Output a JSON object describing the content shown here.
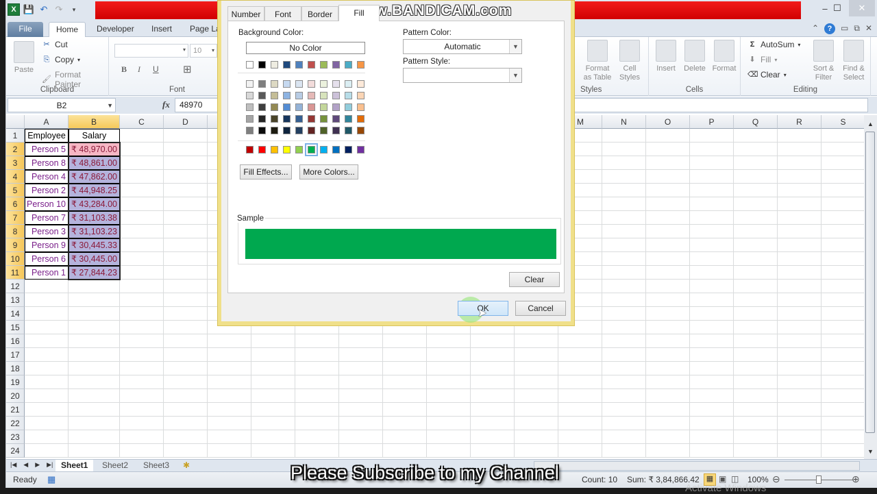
{
  "window": {
    "quick_access": [
      "excel-logo",
      "save",
      "undo",
      "redo",
      "customize"
    ],
    "controls": {
      "minimize": "–",
      "maximize": "☐",
      "close": "✕"
    }
  },
  "ribbon": {
    "tabs": [
      "File",
      "Home",
      "Developer",
      "Insert",
      "Page La"
    ],
    "clipboard": {
      "label": "Clipboard",
      "paste": "Paste",
      "cut": "Cut",
      "copy": "Copy",
      "format_painter": "Format Painter"
    },
    "font": {
      "label": "Font",
      "font_name": "",
      "font_size": "10",
      "bold": "B",
      "italic": "I",
      "underline": "U"
    },
    "styles": {
      "label": "Styles",
      "format_as_table": "Format as Table",
      "cell_styles": "Cell Styles"
    },
    "cells": {
      "label": "Cells",
      "insert": "Insert",
      "delete": "Delete",
      "format": "Format"
    },
    "editing": {
      "label": "Editing",
      "autosum": "AutoSum",
      "fill": "Fill",
      "clear": "Clear",
      "sort_filter": "Sort & Filter",
      "find_select": "Find & Select"
    }
  },
  "formula_bar": {
    "name_box": "B2",
    "fx": "fx",
    "value": "48970"
  },
  "sheet": {
    "columns_left": [
      "A",
      "B",
      "C",
      "D"
    ],
    "columns_right": [
      "M",
      "N",
      "O",
      "P",
      "Q",
      "R",
      "S"
    ],
    "rows": [
      "1",
      "2",
      "3",
      "4",
      "5",
      "6",
      "7",
      "8",
      "9",
      "10",
      "11",
      "12",
      "13",
      "14",
      "15",
      "16",
      "17",
      "18",
      "19",
      "20",
      "21",
      "22",
      "23",
      "24"
    ],
    "headers": {
      "employee": "Employee",
      "salary": "Salary"
    },
    "data": [
      {
        "employee": "Person 5",
        "salary": "₹ 48,970.00"
      },
      {
        "employee": "Person 8",
        "salary": "₹ 48,861.00"
      },
      {
        "employee": "Person 4",
        "salary": "₹ 47,862.00"
      },
      {
        "employee": "Person 2",
        "salary": "₹ 44,948.25"
      },
      {
        "employee": "Person 10",
        "salary": "₹ 43,284.00"
      },
      {
        "employee": "Person 7",
        "salary": "₹ 31,103.38"
      },
      {
        "employee": "Person 3",
        "salary": "₹ 31,103.23"
      },
      {
        "employee": "Person 9",
        "salary": "₹ 30,445.33"
      },
      {
        "employee": "Person 6",
        "salary": "₹ 30,445.00"
      },
      {
        "employee": "Person 1",
        "salary": "₹ 27,844.23"
      }
    ],
    "tabs": [
      "Sheet1",
      "Sheet2",
      "Sheet3"
    ],
    "active_tab": "Sheet1"
  },
  "status": {
    "ready": "Ready",
    "count": "Count: 10",
    "sum": "Sum: ₹ 3,84,866.42",
    "zoom": "100%",
    "zoom_level_percent": 100
  },
  "dialog": {
    "tabs": [
      "Number",
      "Font",
      "Border",
      "Fill"
    ],
    "active_tab": "Fill",
    "background_color_label": "Background Color:",
    "no_color": "No Color",
    "pattern_color_label": "Pattern Color:",
    "pattern_color_value": "Automatic",
    "pattern_style_label": "Pattern Style:",
    "pattern_style_value": "",
    "fill_effects": "Fill Effects...",
    "more_colors": "More Colors...",
    "sample_label": "Sample",
    "sample_color": "#00a84f",
    "clear": "Clear",
    "ok": "OK",
    "cancel": "Cancel",
    "theme_row": [
      "#ffffff",
      "#000000",
      "#eeece1",
      "#1f497d",
      "#4f81bd",
      "#c0504d",
      "#9bbb59",
      "#8064a2",
      "#4bacc6",
      "#f79646"
    ],
    "tint_rows": [
      [
        "#f2f2f2",
        "#7f7f7f",
        "#ddd9c3",
        "#c6d9f0",
        "#dbe5f1",
        "#f2dcdb",
        "#ebf1dd",
        "#e5e0ec",
        "#dbeef3",
        "#fdeada"
      ],
      [
        "#d8d8d8",
        "#595959",
        "#c4bd97",
        "#8db3e2",
        "#b8cce4",
        "#e5b9b7",
        "#d7e3bc",
        "#ccc1d9",
        "#b7dde8",
        "#fbd5b5"
      ],
      [
        "#bfbfbf",
        "#3f3f3f",
        "#938953",
        "#548dd4",
        "#95b3d7",
        "#d99694",
        "#c3d69b",
        "#b2a2c7",
        "#92cddc",
        "#fac08f"
      ],
      [
        "#a5a5a5",
        "#262626",
        "#494429",
        "#17365d",
        "#366092",
        "#953734",
        "#76923c",
        "#5f497a",
        "#31859b",
        "#e36c09"
      ],
      [
        "#7f7f7f",
        "#0c0c0c",
        "#1d1b10",
        "#0f243e",
        "#244061",
        "#632423",
        "#4f6128",
        "#3f3151",
        "#205867",
        "#974806"
      ]
    ],
    "standard_row": [
      "#c00000",
      "#ff0000",
      "#ffc000",
      "#ffff00",
      "#92d050",
      "#00b050",
      "#00b0f0",
      "#0070c0",
      "#002060",
      "#7030a0"
    ],
    "selected_standard_index": 5
  },
  "overlay": {
    "watermark": "www.BANDICAM.com",
    "subscribe": "Please Subscribe to my Channel",
    "activate": "Activate Windows"
  }
}
